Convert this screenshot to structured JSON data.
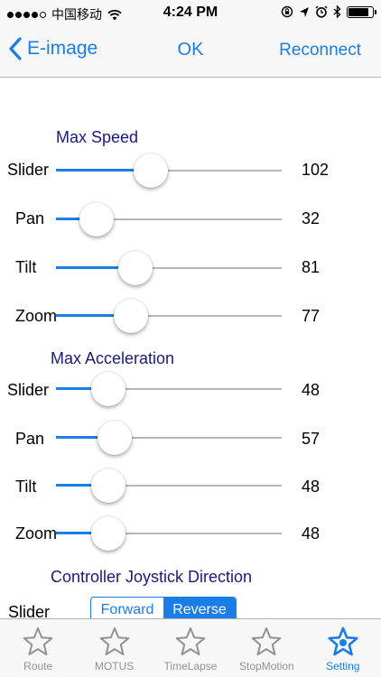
{
  "status_bar": {
    "carrier": "中国移动",
    "time": "4:24 PM",
    "signal_bars_filled": 4,
    "signal_bars_total": 5,
    "battery_level": 0.85
  },
  "nav": {
    "back_label": "E-image",
    "title": "OK",
    "right_label": "Reconnect"
  },
  "sections": {
    "max_speed": "Max Speed",
    "max_acceleration": "Max Acceleration",
    "joystick": "Controller Joystick Direction"
  },
  "max_speed": [
    {
      "label": "Slider",
      "value": "102",
      "level": 0.42
    },
    {
      "label": "Pan",
      "value": "32",
      "level": 0.18
    },
    {
      "label": "Tilt",
      "value": "81",
      "level": 0.35
    },
    {
      "label": "Zoom",
      "value": "77",
      "level": 0.33
    }
  ],
  "max_acceleration": [
    {
      "label": "Slider",
      "value": "48",
      "level": 0.23
    },
    {
      "label": "Pan",
      "value": "57",
      "level": 0.26
    },
    {
      "label": "Tilt",
      "value": "48",
      "level": 0.23
    },
    {
      "label": "Zoom",
      "value": "48",
      "level": 0.23
    }
  ],
  "joystick": {
    "row_label": "Slider",
    "options": [
      "Forward",
      "Reverse"
    ],
    "selected": "Reverse"
  },
  "tabs": [
    {
      "label": "Route",
      "icon": "star-outline-icon",
      "active": false
    },
    {
      "label": "MOTUS",
      "icon": "star-outline-icon",
      "active": false
    },
    {
      "label": "TimeLapse",
      "icon": "star-outline-icon",
      "active": false
    },
    {
      "label": "StopMotion",
      "icon": "star-outline-icon",
      "active": false
    },
    {
      "label": "Setting",
      "icon": "star-settings-icon",
      "active": true
    }
  ],
  "colors": {
    "accent": "#1a7ee6",
    "section_title": "#1a1a7a",
    "tab_inactive": "#929292"
  }
}
